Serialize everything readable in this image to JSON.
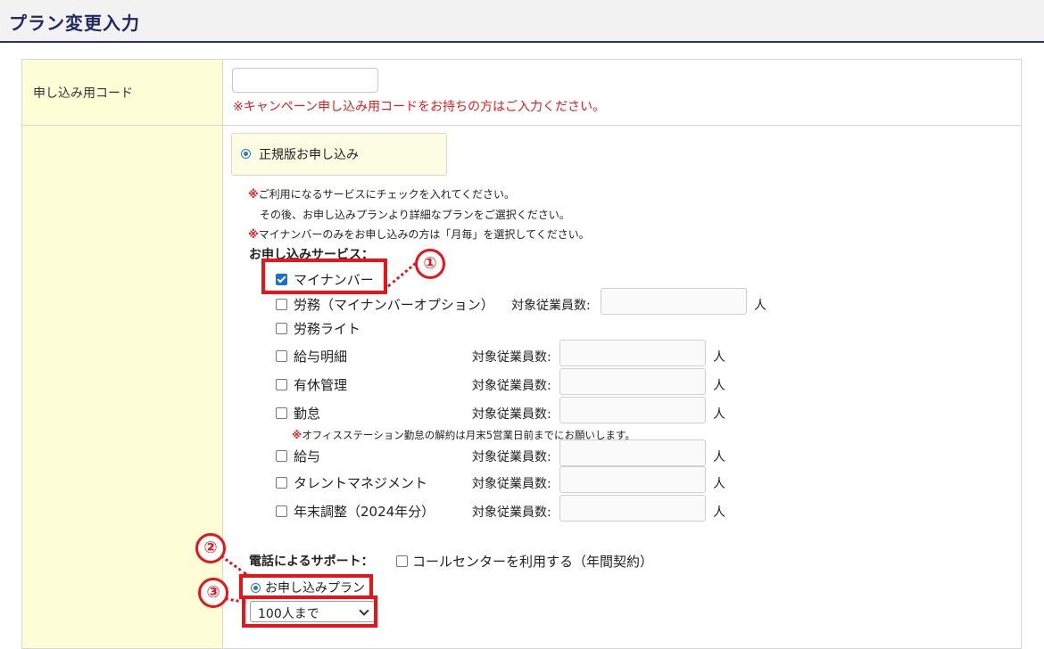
{
  "header": {
    "title": "プラン変更入力"
  },
  "code_section": {
    "label": "申し込み用コード",
    "input_value": "",
    "note": "※キャンペーン申し込み用コードをお持ちの方はご入力ください。"
  },
  "plan": {
    "label": "正規版お申し込み"
  },
  "notes": [
    {
      "mark": "※",
      "text": "ご利用になるサービスにチェックを入れてください。"
    },
    {
      "mark": "",
      "text": "その後、お申し込みプランより詳細なプランをご選択ください。"
    },
    {
      "mark": "※",
      "text": "マイナンバーのみをお申し込みの方は「月毎」を選択してください。"
    }
  ],
  "services": {
    "heading": "お申し込みサービス：",
    "employee_label": "対象従業員数:",
    "unit": "人",
    "items": [
      {
        "name": "マイナンバー",
        "checked": true
      },
      {
        "name": "労務（マイナンバーオプション）",
        "checked": false
      },
      {
        "name": "労務ライト",
        "checked": false
      },
      {
        "name": "給与明細",
        "checked": false
      },
      {
        "name": "有休管理",
        "checked": false
      },
      {
        "name": "勤怠",
        "checked": false
      },
      {
        "name": "給与",
        "checked": false
      },
      {
        "name": "タレントマネジメント",
        "checked": false
      },
      {
        "name": "年末調整（2024年分）",
        "checked": false
      }
    ],
    "attendance_note": {
      "mark": "※",
      "text": "オフィスステーション勤怠の解約は月末5営業日前までにお願いします。"
    }
  },
  "phone_support": {
    "label": "電話によるサポート：",
    "option": "コールセンターを利用する（年間契約）",
    "checked": false
  },
  "application_plan": {
    "label": "お申し込みプラン",
    "selected": "100人まで"
  },
  "annotations": [
    "①",
    "②",
    "③"
  ],
  "colors": {
    "highlight": "#e8141a",
    "header_text": "#1f2a63",
    "label_bg": "#fefed6",
    "note_red": "#e02020"
  }
}
